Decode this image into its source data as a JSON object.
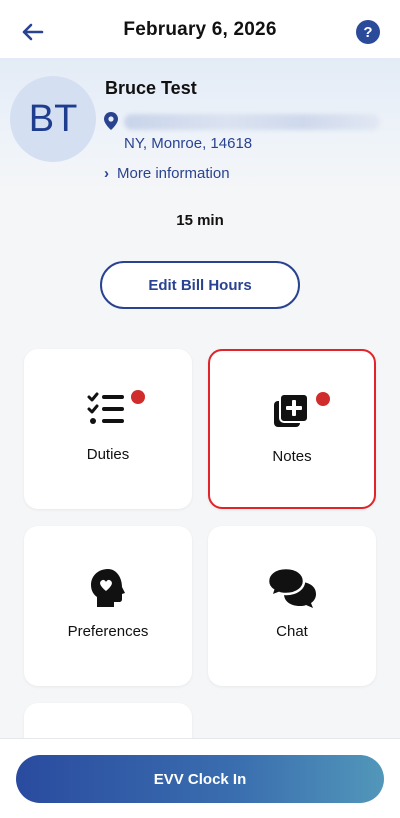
{
  "header": {
    "date": "February 6, 2026",
    "back_icon": "arrow-left-icon",
    "help_label": "?"
  },
  "client": {
    "initials": "BT",
    "name": "Bruce Test",
    "address_icon": "map-pin-icon",
    "city_line": "NY, Monroe, 14618",
    "more_info_label": "More information"
  },
  "visit": {
    "duration": "15 min",
    "edit_bill_hours_label": "Edit Bill Hours"
  },
  "tiles": [
    {
      "label": "Duties",
      "icon": "checklist-icon",
      "has_badge": true,
      "selected": false
    },
    {
      "label": "Notes",
      "icon": "add-note-icon",
      "has_badge": true,
      "selected": true
    },
    {
      "label": "Preferences",
      "icon": "head-heart-icon",
      "has_badge": false,
      "selected": false
    },
    {
      "label": "Chat",
      "icon": "chat-bubbles-icon",
      "has_badge": false,
      "selected": false
    }
  ],
  "footer": {
    "evv_button_label": "EVV Clock In"
  },
  "colors": {
    "brand_blue": "#2a4391",
    "badge_red": "#d12c2c",
    "selected_border": "#e0242a"
  }
}
